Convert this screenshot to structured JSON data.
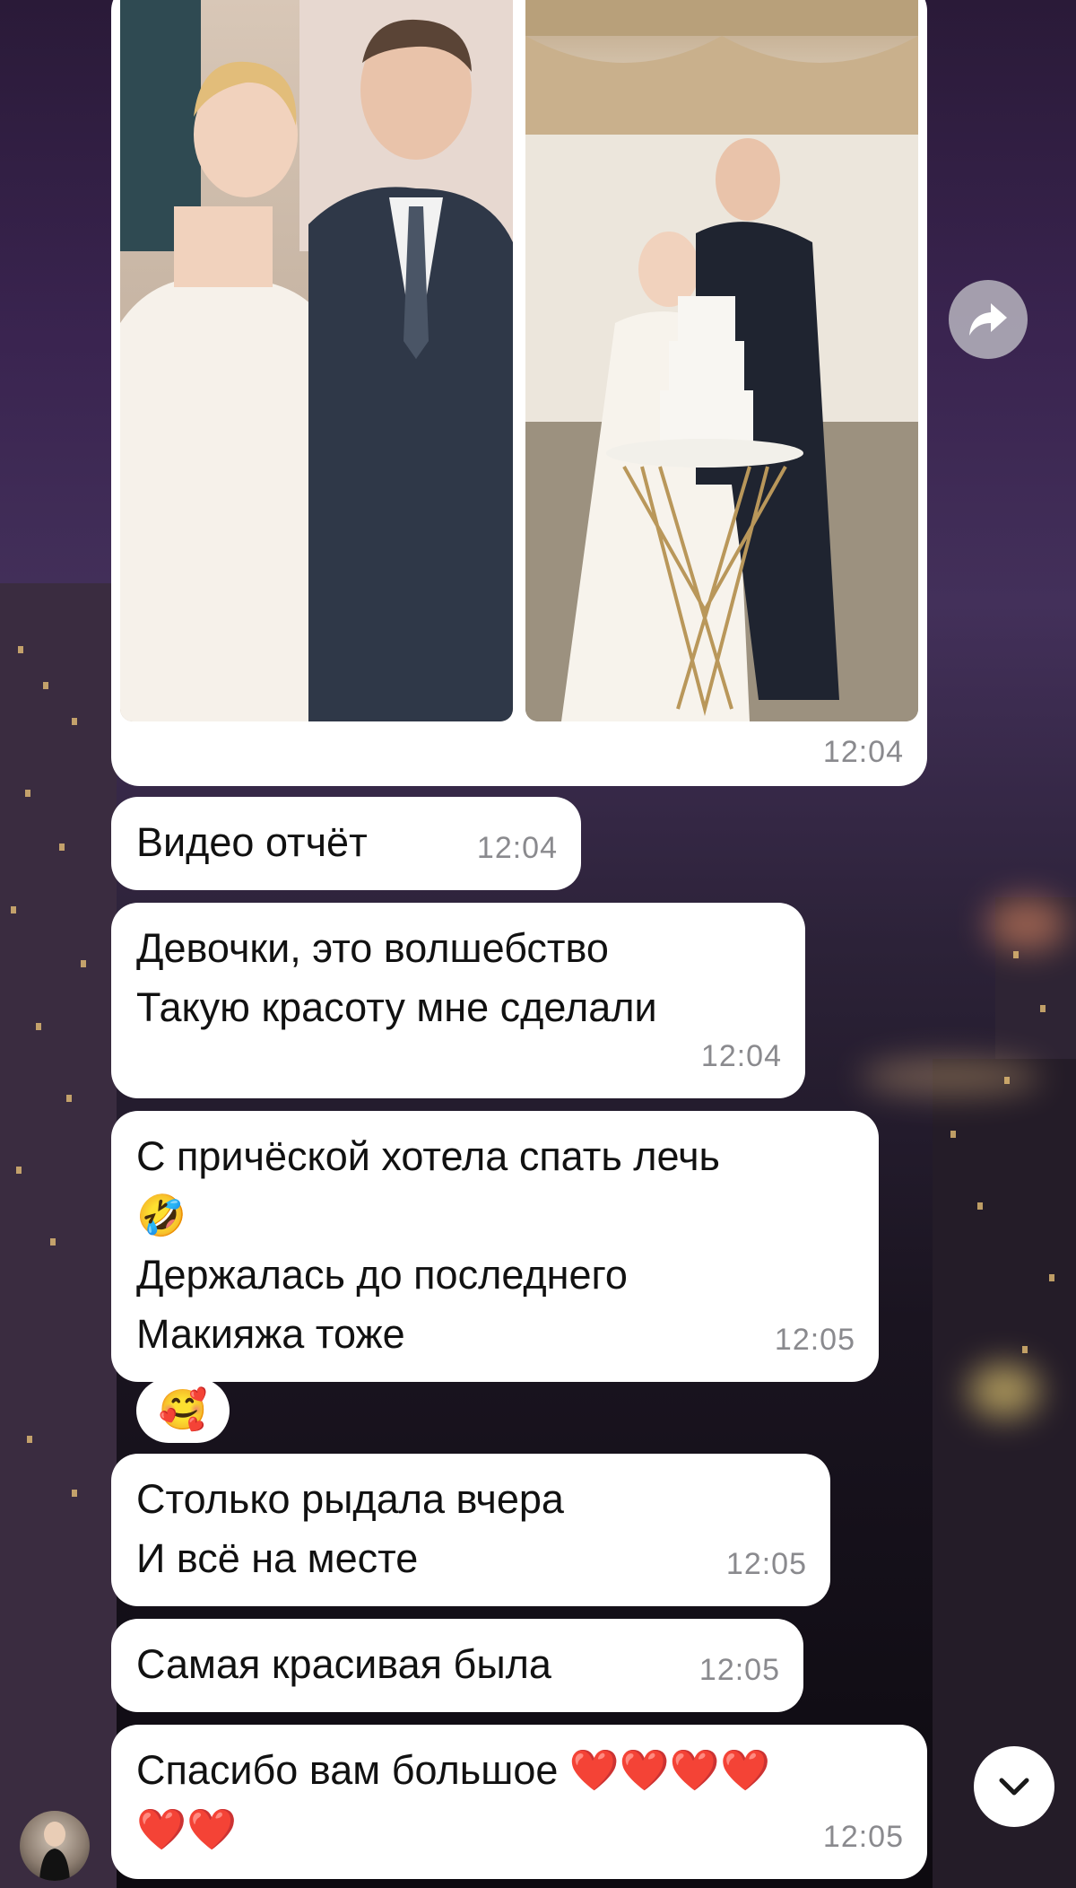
{
  "photo_message": {
    "time": "12:04"
  },
  "messages": [
    {
      "lines": [
        "Видео отчёт"
      ],
      "time": "12:04"
    },
    {
      "lines": [
        "Девочки, это волшебство",
        "Такую красоту мне сделали"
      ],
      "time": "12:04"
    },
    {
      "lines": [
        "С причёской хотела спать лечь",
        "🤣",
        "Держалась до последнего",
        "Макияжа тоже"
      ],
      "time": "12:05"
    },
    {
      "lines": [
        "Столько рыдала вчера",
        "И всё на месте"
      ],
      "time": "12:05"
    },
    {
      "lines": [
        "Самая красивая была"
      ],
      "time": "12:05"
    },
    {
      "lines": [
        "Спасибо вам большое ❤️❤️❤️❤️",
        "❤️❤️"
      ],
      "time": "12:05"
    }
  ],
  "reaction": {
    "emoji": "🥰"
  },
  "icons": {
    "forward": "forward-arrow-icon",
    "scroll_down": "chevron-down-icon"
  },
  "colors": {
    "bubble": "#ffffff",
    "time": "#8a8a8e",
    "heart": "#e02020"
  }
}
